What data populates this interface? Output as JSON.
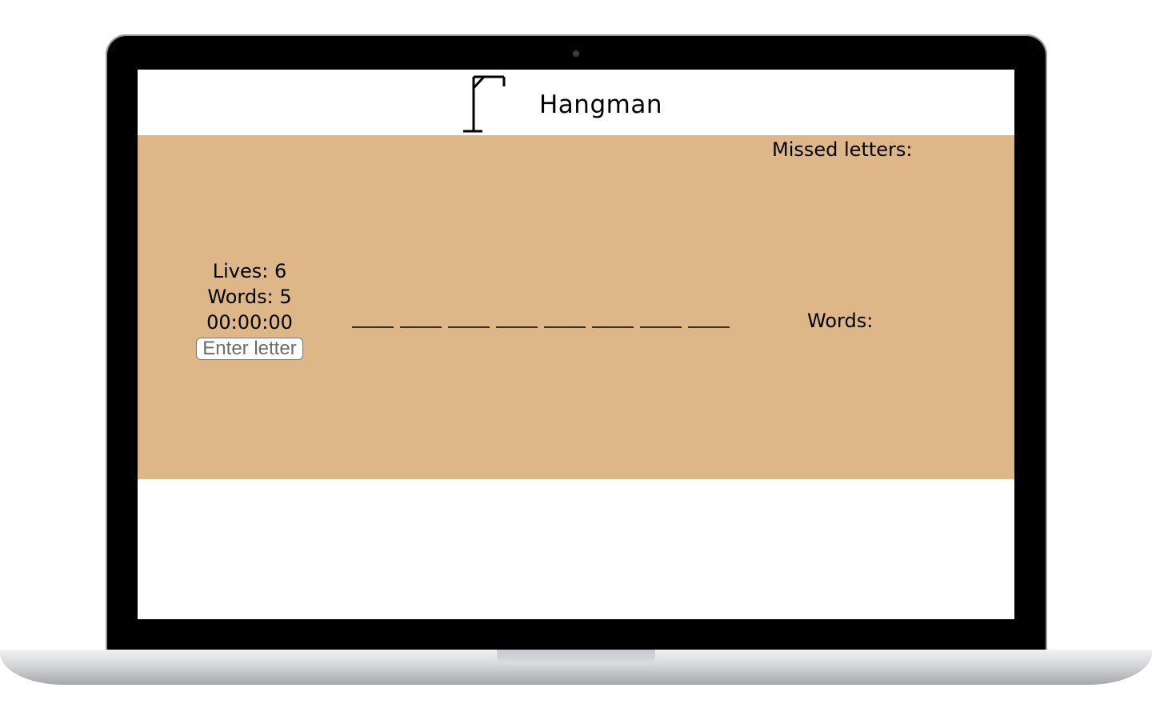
{
  "header": {
    "title": "Hangman",
    "logo_icon": "gallows-icon"
  },
  "stats": {
    "lives": "Lives: 6",
    "words": "Words: 5",
    "timer": "00:00:00"
  },
  "input": {
    "placeholder": "Enter letter"
  },
  "word": {
    "slots": 8
  },
  "sidebar": {
    "missed_label": "Missed letters:",
    "words_label": "Words:"
  },
  "colors": {
    "board": "#ddb787",
    "text": "#000000"
  }
}
